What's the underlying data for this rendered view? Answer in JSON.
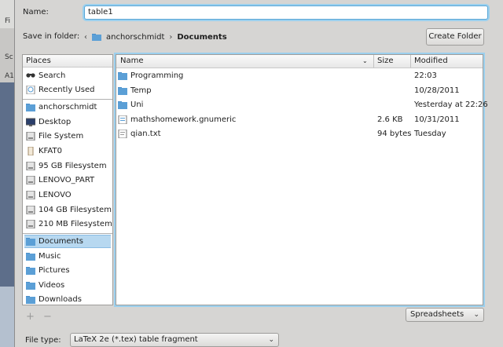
{
  "dialog": {
    "name_label": "Name:",
    "name_value": "table1",
    "save_in_label": "Save in folder:",
    "breadcrumb": {
      "parent": "anchorschmidt",
      "current": "Documents"
    },
    "create_folder_label": "Create Folder"
  },
  "places": {
    "header": "Places",
    "items": [
      {
        "label": "Search",
        "icon": "search-icon"
      },
      {
        "label": "Recently Used",
        "icon": "recent-icon"
      },
      {
        "label": "anchorschmidt",
        "icon": "home-folder-icon"
      },
      {
        "label": "Desktop",
        "icon": "desktop-icon"
      },
      {
        "label": "File System",
        "icon": "drive-icon"
      },
      {
        "label": "KFAT0",
        "icon": "usb-drive-icon"
      },
      {
        "label": "95 GB Filesystem",
        "icon": "drive-icon"
      },
      {
        "label": "LENOVO_PART",
        "icon": "drive-icon"
      },
      {
        "label": "LENOVO",
        "icon": "drive-icon"
      },
      {
        "label": "104 GB Filesystem",
        "icon": "drive-icon"
      },
      {
        "label": "210 MB Filesystem",
        "icon": "drive-icon"
      },
      {
        "label": "Documents",
        "icon": "folder-icon"
      },
      {
        "label": "Music",
        "icon": "folder-icon"
      },
      {
        "label": "Pictures",
        "icon": "folder-icon"
      },
      {
        "label": "Videos",
        "icon": "folder-icon"
      },
      {
        "label": "Downloads",
        "icon": "folder-icon"
      }
    ],
    "add_symbol": "+",
    "remove_symbol": "−"
  },
  "files": {
    "columns": {
      "name": "Name",
      "size": "Size",
      "modified": "Modified"
    },
    "rows": [
      {
        "name": "Programming",
        "size": "",
        "modified": "22:03",
        "icon": "folder-icon"
      },
      {
        "name": "Temp",
        "size": "",
        "modified": "10/28/2011",
        "icon": "folder-icon"
      },
      {
        "name": "Uni",
        "size": "",
        "modified": "Yesterday at 22:26",
        "icon": "folder-icon"
      },
      {
        "name": "mathshomework.gnumeric",
        "size": "2.6 KB",
        "modified": "10/31/2011",
        "icon": "spreadsheet-file-icon"
      },
      {
        "name": "qian.txt",
        "size": "94 bytes",
        "modified": "Tuesday",
        "icon": "text-file-icon"
      }
    ]
  },
  "filter": {
    "value": "Spreadsheets"
  },
  "file_type": {
    "label": "File type:",
    "value": "LaTeX 2e (*.tex) table fragment"
  },
  "background_app": {
    "fragments": [
      "Fi",
      "Sc",
      "A1"
    ]
  },
  "colors": {
    "accent": "#5aa6d6",
    "selection": "#b7d8f0",
    "folder": "#5b9fd6"
  }
}
